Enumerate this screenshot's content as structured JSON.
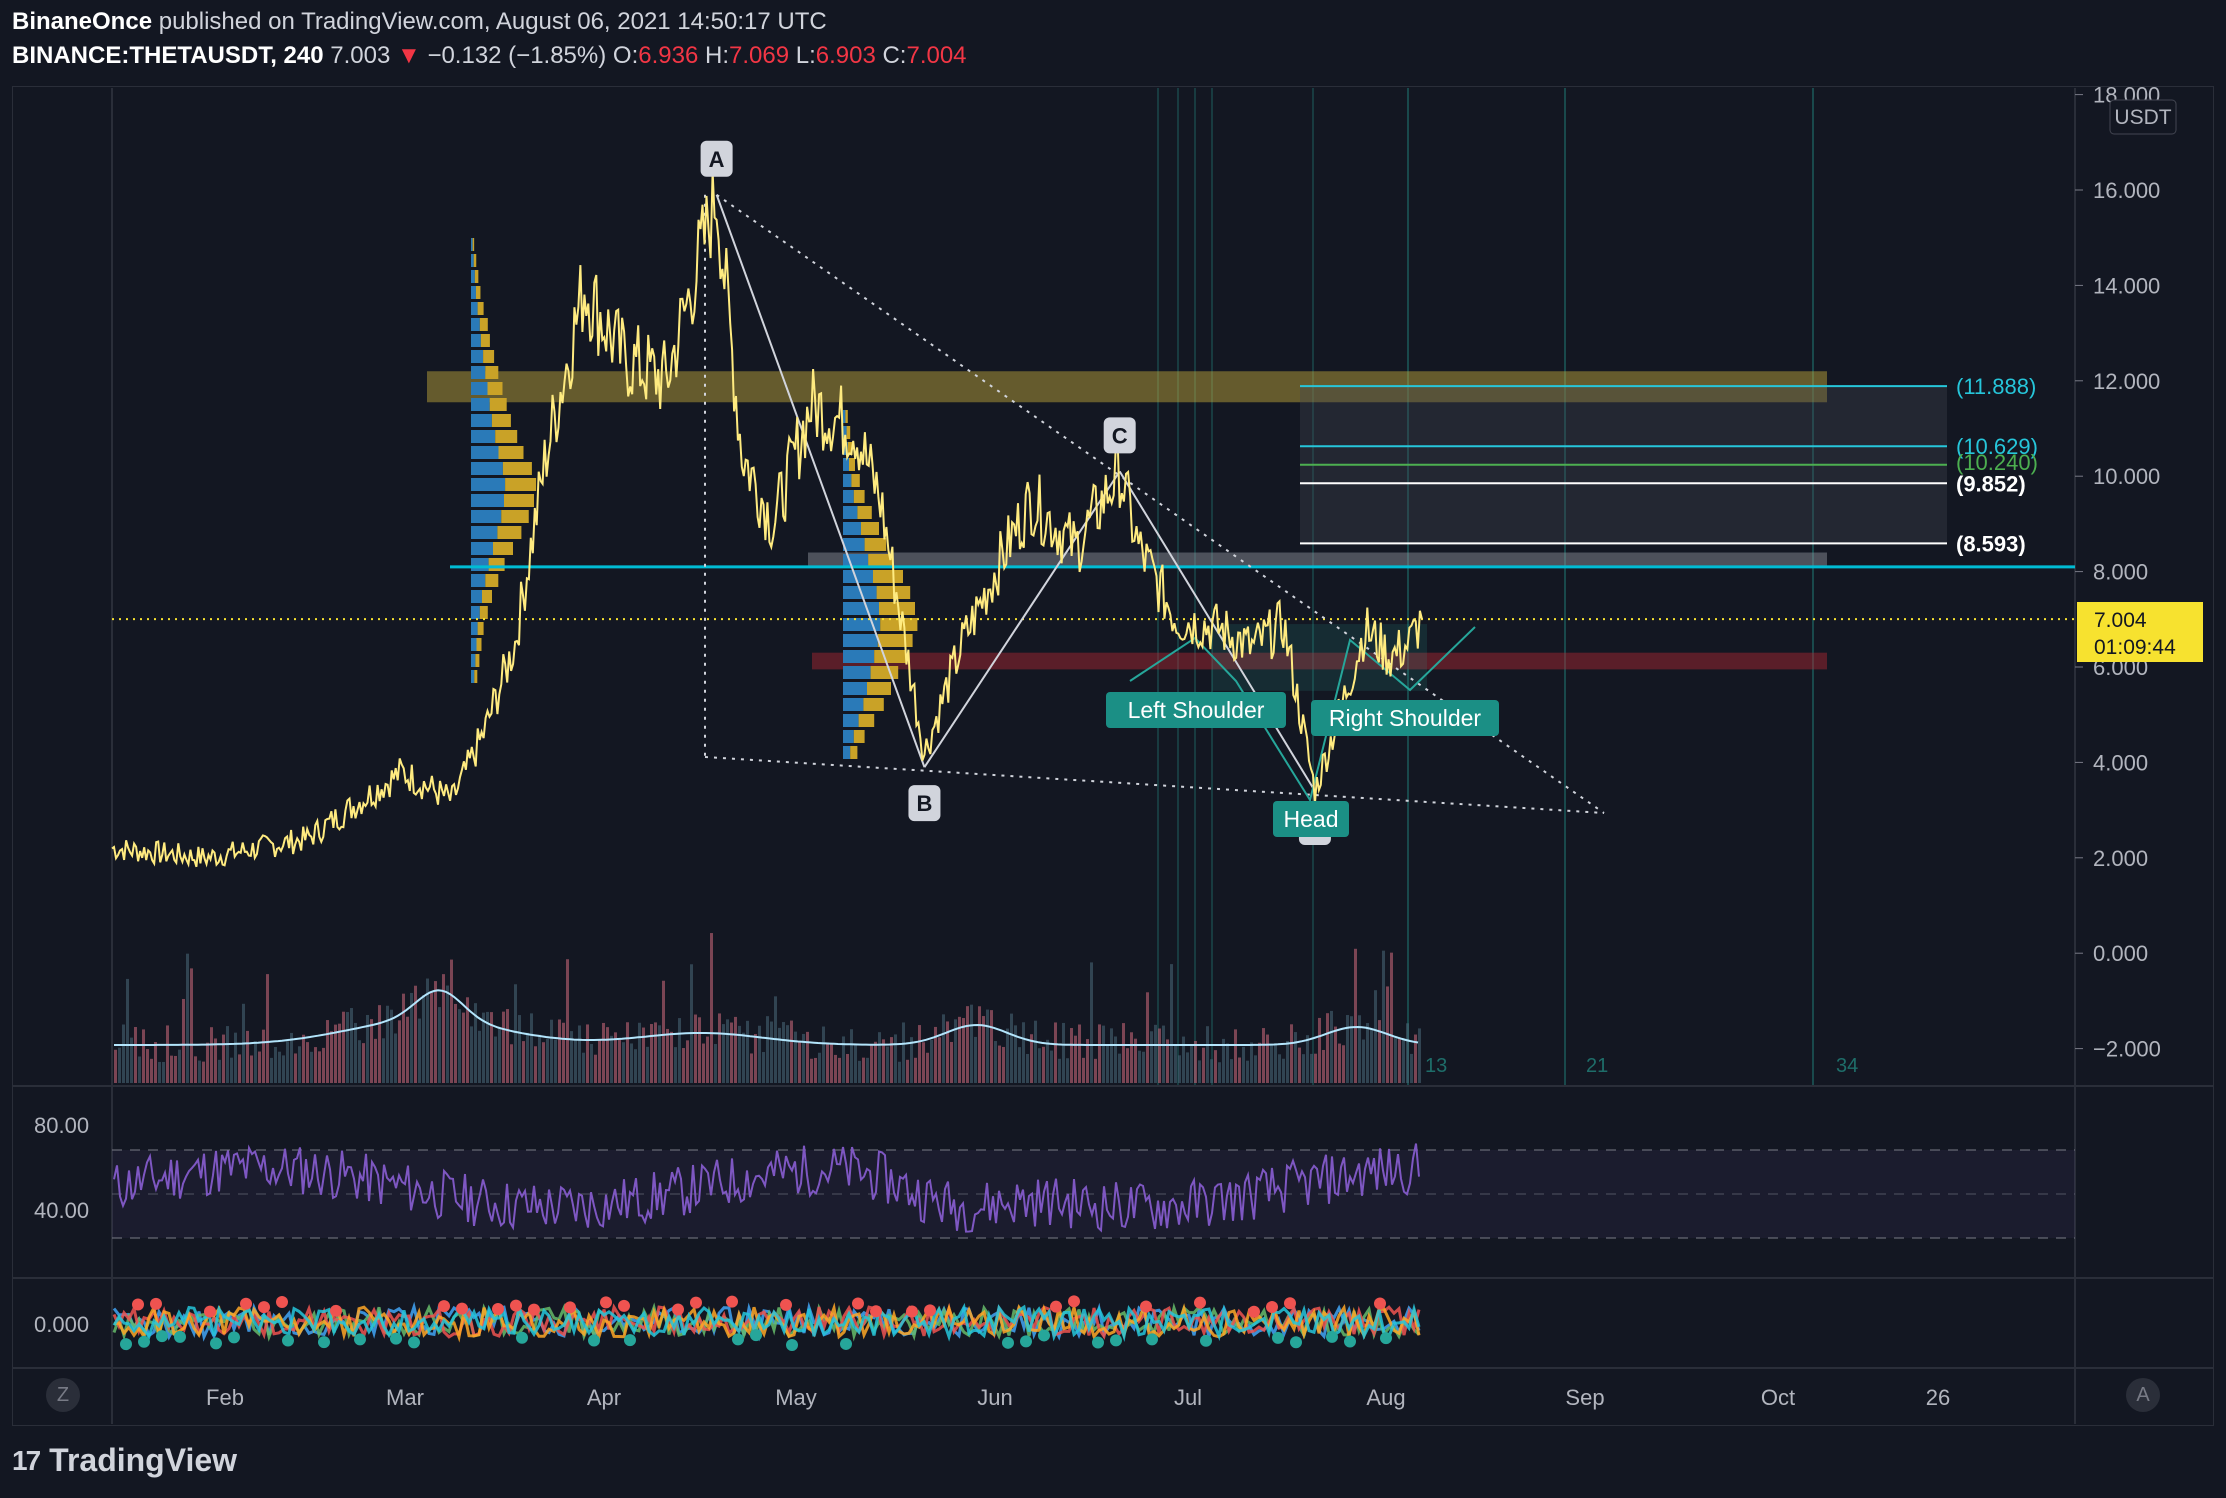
{
  "header": {
    "author": "BinaneOnce",
    "published_text": "published on TradingView.com, August 06, 2021 14:50:17 UTC",
    "symbol": "BINANCE:THETAUSDT, 240",
    "last": "7.003",
    "change_arrow": "▼",
    "change": "−0.132 (−1.85%)",
    "open_label": "O:",
    "open": "6.936",
    "high_label": "H:",
    "high": "7.069",
    "low_label": "L:",
    "low": "6.903",
    "close_label": "C:",
    "close": "7.004"
  },
  "currency_badge": "USDT",
  "price_axis": [
    "18.000",
    "16.000",
    "14.000",
    "12.000",
    "10.000",
    "8.000",
    "6.000",
    "4.000",
    "2.000",
    "0.000",
    "−2.000"
  ],
  "current_price": {
    "value": "7.004",
    "countdown": "01:09:44"
  },
  "fib_levels": [
    {
      "label": "(11.888)",
      "value": 11.888,
      "color": "#26c6da"
    },
    {
      "label": "(10.629)",
      "value": 10.629,
      "color": "#26c6da"
    },
    {
      "label": "(10.240)",
      "value": 10.24,
      "color": "#4caf50"
    },
    {
      "label": "(9.852)",
      "value": 9.852,
      "color": "#ffffff"
    },
    {
      "label": "(8.593)",
      "value": 8.593,
      "color": "#ffffff"
    }
  ],
  "pattern_points": [
    {
      "label": "A",
      "date": "2021-04-16",
      "price": 15.9
    },
    {
      "label": "B",
      "date": "2021-05-19",
      "price": 3.9
    },
    {
      "label": "C",
      "date": "2021-06-19",
      "price": 10.1
    },
    {
      "label": "D",
      "date": "2021-07-20",
      "price": 3.4
    }
  ],
  "pattern_labels": [
    "Left Shoulder",
    "Head",
    "Right Shoulder"
  ],
  "fib_time_labels": [
    "13",
    "21",
    "34"
  ],
  "rsi_axis": [
    "80.00",
    "40.00"
  ],
  "osc_axis": [
    "0.000"
  ],
  "time_axis": [
    "Feb",
    "Mar",
    "Apr",
    "May",
    "Jun",
    "Jul",
    "Aug",
    "Sep",
    "Oct",
    "26"
  ],
  "corner_buttons": {
    "left": "Z",
    "right": "A"
  },
  "footer": {
    "brand": "TradingView",
    "logo_text": "17"
  },
  "colors": {
    "price": "#ffeb80",
    "support": "#00bcd4",
    "rsi": "#7e57c2",
    "accent": "#26a69a"
  },
  "chart_data": {
    "type": "line",
    "title": "BINANCE:THETAUSDT, 240",
    "ylabel": "USDT",
    "ylim": [
      -2.5,
      18.3
    ],
    "x": [
      "2021-01-10",
      "2021-01-25",
      "2021-02-10",
      "2021-02-25",
      "2021-03-05",
      "2021-03-10",
      "2021-03-15",
      "2021-03-20",
      "2021-03-26",
      "2021-04-01",
      "2021-04-08",
      "2021-04-16",
      "2021-04-20",
      "2021-04-25",
      "2021-05-01",
      "2021-05-08",
      "2021-05-12",
      "2021-05-19",
      "2021-05-25",
      "2021-06-01",
      "2021-06-05",
      "2021-06-12",
      "2021-06-19",
      "2021-06-22",
      "2021-06-28",
      "2021-07-05",
      "2021-07-10",
      "2021-07-15",
      "2021-07-20",
      "2021-07-25",
      "2021-07-28",
      "2021-08-01",
      "2021-08-04",
      "2021-08-06"
    ],
    "series": [
      {
        "values": [
          2.2,
          2.0,
          2.4,
          3.8,
          3.2,
          4.6,
          6.5,
          10.5,
          14.0,
          12.5,
          12.0,
          15.9,
          10.5,
          9.0,
          11.5,
          11.0,
          9.5,
          4.2,
          6.5,
          8.5,
          9.5,
          8.5,
          10.1,
          8.5,
          7.0,
          6.8,
          6.4,
          6.9,
          3.4,
          5.5,
          6.8,
          6.2,
          6.5,
          7.0
        ]
      }
    ],
    "horizontal_levels": [
      8.1,
      7.004
    ]
  }
}
